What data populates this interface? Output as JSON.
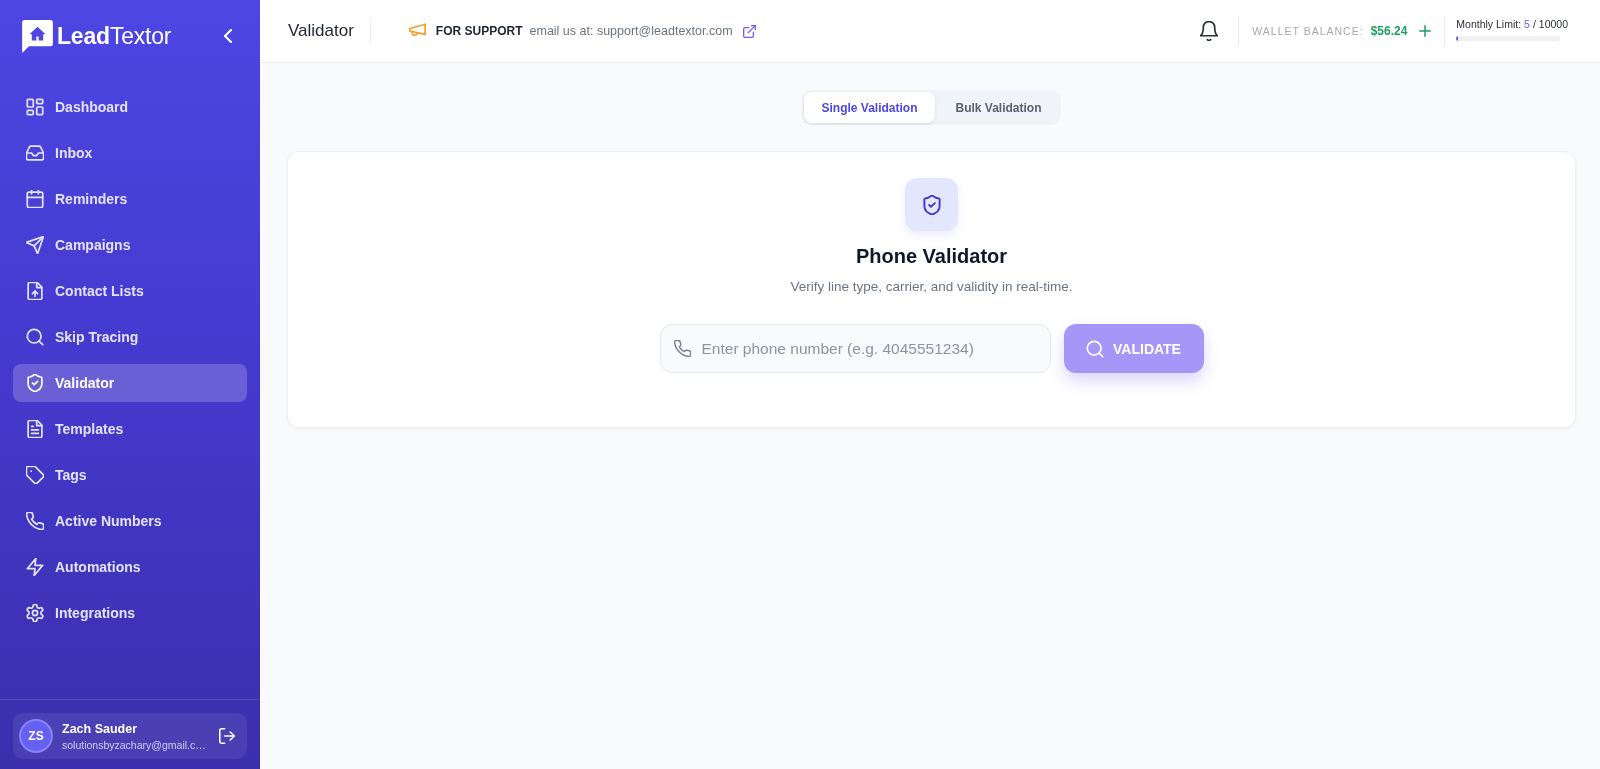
{
  "sidebar": {
    "logo": "**Lead**Textor",
    "nav_items": [
      {
        "label": "Dashboard",
        "selected": false
      },
      {
        "label": "Inbox",
        "selected": false
      },
      {
        "label": "Reminders",
        "selected": false
      },
      {
        "label": "Campaigns",
        "selected": false
      },
      {
        "label": "Contact Lists",
        "selected": false
      },
      {
        "label": "Skip Tracing",
        "selected": false
      },
      {
        "label": "Validator",
        "selected": true
      },
      {
        "label": "Templates",
        "selected": false
      },
      {
        "label": "Tags",
        "selected": false
      },
      {
        "label": "Active Numbers",
        "selected": false
      },
      {
        "label": "Automations",
        "selected": false
      },
      {
        "label": "Integrations",
        "selected": false
      }
    ],
    "user": {
      "initials": "ZS",
      "name": "Zach Sauder",
      "email": "solutionsbyzachary@gmail.c…"
    }
  },
  "header": {
    "title": "Validator",
    "support": {
      "label": "FOR SUPPORT",
      "text": "email us at: support@leadtextor.com"
    },
    "wallet": {
      "label": "WALLET BALANCE:",
      "amount": "$56.24"
    },
    "monthly_limit": {
      "label": "Monthly Limit:",
      "used": "5",
      "total": "/ 10000",
      "level": 0.0005
    }
  },
  "tabs": [
    {
      "label": "Single Validation",
      "selected": true
    },
    {
      "label": "Bulk Validation",
      "selected": false
    }
  ],
  "validator": {
    "title": "Phone Validator",
    "subtitle": "Verify line type, carrier, and validity in real-time.",
    "input": {
      "placeholder": "Enter phone number (e.g. 4045551234)"
    },
    "button": {
      "label": "VALIDATE",
      "disabled": true
    }
  }
}
